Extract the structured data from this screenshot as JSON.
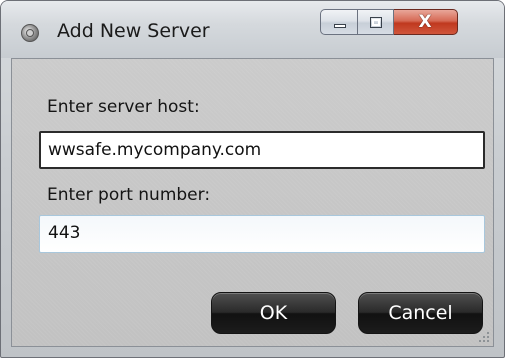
{
  "window": {
    "title": "Add New Server",
    "caption_buttons": {
      "minimize_icon": "minimize-icon",
      "maximize_icon": "maximize-icon",
      "close_glyph": "X"
    }
  },
  "form": {
    "host_label": "Enter server host:",
    "host_value": "wwsafe.mycompany.com",
    "port_label": "Enter port number:",
    "port_value": "443"
  },
  "buttons": {
    "ok_label": "OK",
    "cancel_label": "Cancel"
  },
  "colors": {
    "close_button": "#c0391f",
    "action_button": "#1c1c1c",
    "focused_border": "#2b2b2b",
    "hover_border": "#a8c7dc"
  }
}
